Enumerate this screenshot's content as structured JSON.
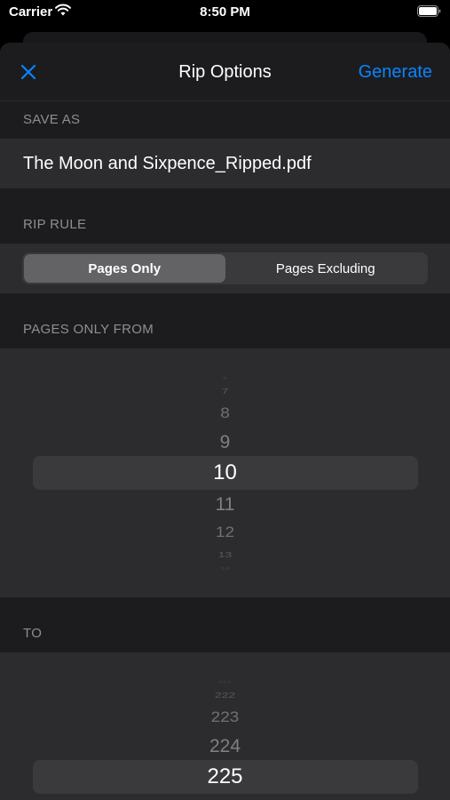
{
  "status_bar": {
    "carrier": "Carrier",
    "time": "8:50 PM"
  },
  "nav": {
    "title": "Rip Options",
    "generate_label": "Generate",
    "close_icon": "close-icon"
  },
  "save_as": {
    "header": "SAVE AS",
    "filename": "The Moon and Sixpence_Ripped.pdf"
  },
  "rip_rule": {
    "header": "RIP RULE",
    "options": [
      "Pages Only",
      "Pages Excluding"
    ],
    "selected": "Pages Only"
  },
  "from_picker": {
    "header": "PAGES ONLY FROM",
    "values": [
      "6",
      "7",
      "8",
      "9",
      "10",
      "11",
      "12",
      "13",
      "14"
    ],
    "selected": "10"
  },
  "to_picker": {
    "header": "TO",
    "values": [
      "221",
      "222",
      "223",
      "224",
      "225"
    ],
    "selected": "225"
  },
  "colors": {
    "accent": "#0a84ff",
    "background": "#1c1c1e",
    "cell": "#2c2c2e",
    "secondary_text": "#8e8e93"
  }
}
